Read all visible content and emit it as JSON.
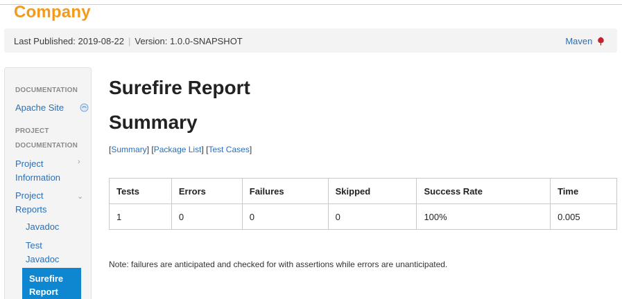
{
  "brand": {
    "name": "Company",
    "color": "#f39a1e"
  },
  "banner": {
    "published": "Last Published: 2019-08-22",
    "separator": "|",
    "version": "Version: 1.0.0-SNAPSHOT",
    "maven_link": "Maven"
  },
  "sidebar": {
    "header_documentation": "DOCUMENTATION",
    "apache_site": "Apache Site",
    "header_project_documentation_1": "PROJECT",
    "header_project_documentation_2": "DOCUMENTATION",
    "project_information_1": "Project",
    "project_information_2": "Information",
    "project_reports_1": "Project",
    "project_reports_2": "Reports",
    "javadoc": "Javadoc",
    "test_javadoc_1": "Test",
    "test_javadoc_2": "Javadoc",
    "surefire_report_1": "Surefire",
    "surefire_report_2": "Report",
    "active_color": "#0e87d0"
  },
  "main": {
    "title": "Surefire Report",
    "subtitle": "Summary",
    "links": [
      {
        "open": "[",
        "label": "Summary",
        "close": "]"
      },
      {
        "open": "[",
        "label": "Package List",
        "close": "]"
      },
      {
        "open": "[",
        "label": "Test Cases",
        "close": "]"
      }
    ],
    "table": {
      "headers": [
        "Tests",
        "Errors",
        "Failures",
        "Skipped",
        "Success Rate",
        "Time"
      ],
      "rows": [
        [
          "1",
          "0",
          "0",
          "0",
          "100%",
          "0.005"
        ]
      ]
    },
    "note": "Note: failures are anticipated and checked for with assertions while errors are unanticipated."
  },
  "colors": {
    "link": "#2a6fb6",
    "banner_bg": "#f3f3f3"
  }
}
